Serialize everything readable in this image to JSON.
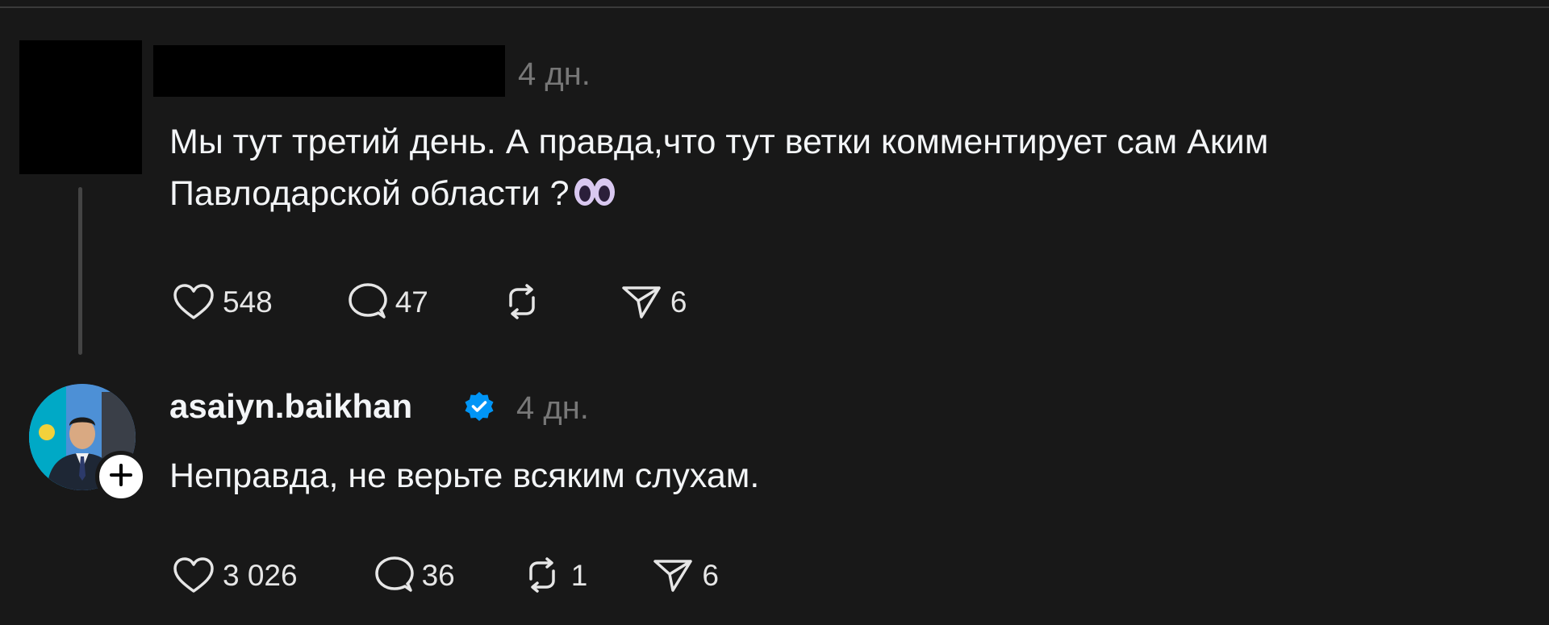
{
  "thread": {
    "parent_post": {
      "timestamp": "4 дн.",
      "text": "Мы тут третий день. А правда,что тут ветки комментирует сам Аким\nПавлодарской области ?",
      "emoji": "eyes-emoji",
      "likes": "548",
      "replies": "47",
      "shares": "6"
    },
    "reply_post": {
      "username": "asaiyn.baikhan",
      "verified": true,
      "timestamp": "4 дн.",
      "text": "Неправда, не верьте всяким слухам.",
      "likes": "3 026",
      "replies": "36",
      "reposts": "1",
      "shares": "6"
    }
  },
  "icons": {
    "like": "heart-icon",
    "reply": "comment-icon",
    "repost": "repost-icon",
    "share": "send-icon",
    "verified": "verified-badge-icon",
    "follow": "plus-icon"
  },
  "colors": {
    "background": "#181818",
    "text": "#f3f5f7",
    "secondary": "#777777",
    "verified": "#0095f6"
  }
}
